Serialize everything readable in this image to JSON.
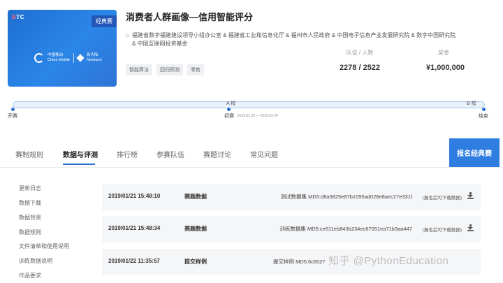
{
  "banner": {
    "brand_prefix": "B",
    "brand_suffix": "TC",
    "badge": "经典赛",
    "logo_left_cn": "中国移动",
    "logo_left_en": "China Mobile",
    "logo_right_cn": "新大陆",
    "logo_right_en": "Newland"
  },
  "competition": {
    "title": "消费者人群画像—信用智能评分",
    "organizers_line1": "福建省数字福建建设领导小组办公室 & 福建省工业和信息化厅 & 福州市人民政府 & 中国电子信息产业发展研究院 & 数字中国研究院",
    "organizers_line2": "& 中国互联网投资基金",
    "tags": [
      "智能算法",
      "回归预测",
      "零售"
    ],
    "teams_label": "队伍 / 人数",
    "teams_value": "2278 / 2522",
    "prize_label": "奖金",
    "prize_value": "¥1,000,000"
  },
  "timeline": {
    "stage_a": "A 榜",
    "stage_b": "B 榜",
    "start_label": "开赛",
    "prelim_label": "初赛",
    "prelim_dates": "2019.01.22 — 2019.03.24",
    "end_label": "结束"
  },
  "tabs": [
    "赛制规则",
    "数据与评测",
    "排行榜",
    "参赛队伍",
    "赛题讨论",
    "常见问题"
  ],
  "cta_label": "报名经典赛",
  "sidebar": [
    "更新日志",
    "数据下载",
    "数据背景",
    "数据规则",
    "文件清单和使用说明",
    "训练数据说明",
    "作品要求"
  ],
  "datasets": [
    {
      "date": "2019/01/21 15:48:10",
      "type": "赛题数据",
      "file": "测试数据集 MD5:d8a5825e87b1095ad028e8aec27e331f",
      "note": "(报名后可下载数据)"
    },
    {
      "date": "2019/01/21 15:48:34",
      "type": "赛题数据",
      "file": "训练数据集 MD5:ce611eb843b234ec67051ea71b3aa447",
      "note": "(报名后可下载数据)"
    },
    {
      "date": "2019/01/22 11:35:57",
      "type": "提交样例",
      "file": "提交样例 MD5:6c6027",
      "note": ""
    }
  ],
  "watermark": "知乎 @PythonEducation",
  "colors": {
    "accent": "#2f7de1",
    "banner": "#2a86e8",
    "row_bg": "#f5f6f8"
  }
}
